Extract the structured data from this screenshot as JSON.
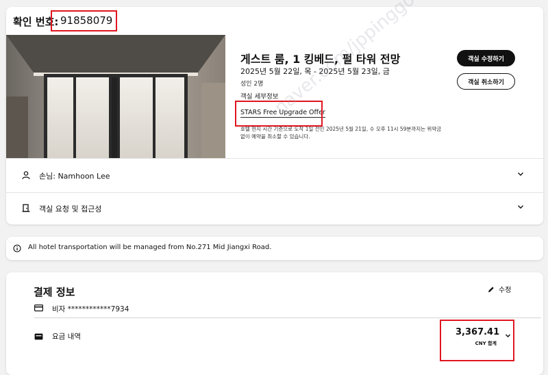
{
  "confirmation": {
    "label": "확인 번호:",
    "number": "91858079"
  },
  "room": {
    "title": "게스트 룸, 1 킹베드, 펄 타워 전망",
    "dates": "2025년 5월 22일, 목 - 2025년 5월 23일, 금",
    "guests": "성인 2명",
    "details_link": "객실 세부정보",
    "offer": "STARS Free Upgrade Offer",
    "cancel_policy": "호텔 현지 시간 기준으로 도착 1일 전인 2025년 5월 21일, 수 오후 11시 59분까지는 위약금 없이 예약을 취소할 수 있습니다.",
    "edit_button": "객실 수정하기",
    "cancel_button": "객실 취소하기"
  },
  "rows": {
    "guest": "손님: Namhoon Lee",
    "requests": "객실 요청 및 접근성"
  },
  "notice": {
    "text": "All hotel transportation will be managed from No.271 Mid Jiangxi Road."
  },
  "payment": {
    "title": "결제 정보",
    "edit": "수정",
    "card": "비자 ************7934",
    "receipt_label": "요금 내역",
    "total_amount": "3,367.41",
    "total_label": "CNY 합계"
  },
  "watermark": "naver.com/jppinggonai",
  "colors": {
    "highlight": "#e0141e",
    "button_dark": "#111111"
  }
}
